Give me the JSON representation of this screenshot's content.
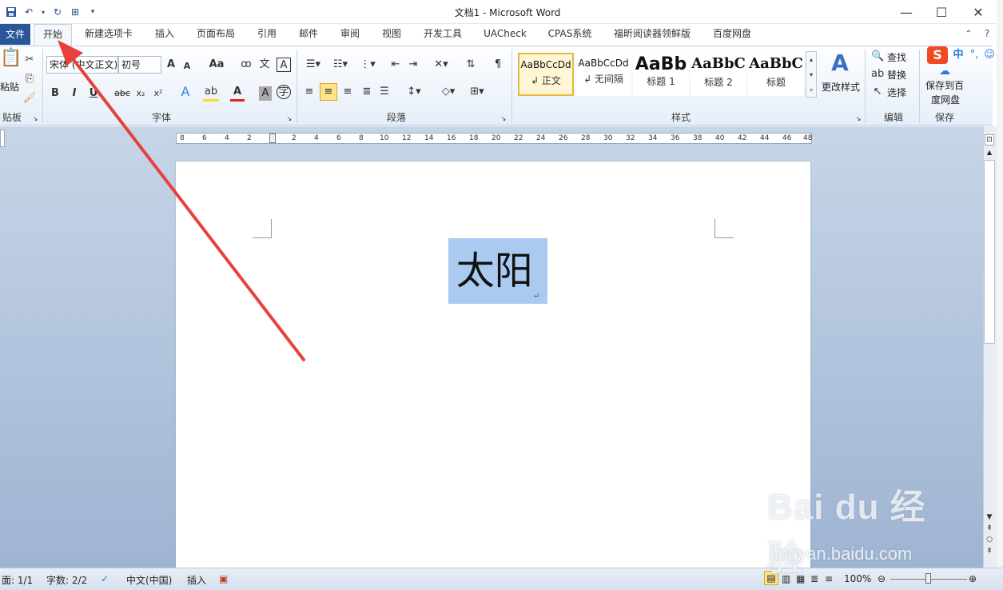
{
  "window": {
    "title": "文档1 - Microsoft Word",
    "minimize": "—",
    "maximize": "☐",
    "close": "✕"
  },
  "tabs": {
    "file": "文件",
    "items": [
      "开始",
      "新建选项卡",
      "插入",
      "页面布局",
      "引用",
      "邮件",
      "审阅",
      "视图",
      "开发工具",
      "UACheck",
      "CPAS系统",
      "福昕阅读器领鲜版",
      "百度网盘"
    ]
  },
  "ribbon": {
    "clipboard": {
      "paste": "粘贴",
      "label": "贴板"
    },
    "font": {
      "font_name": "宋体 (中文正文)",
      "font_size": "初号",
      "label": "字体"
    },
    "paragraph": {
      "label": "段落"
    },
    "styles": {
      "label": "样式",
      "items": [
        {
          "preview": "AaBbCcDd",
          "name": "↲ 正文"
        },
        {
          "preview": "AaBbCcDd",
          "name": "↲ 无间隔"
        },
        {
          "preview": "AaBb",
          "name": "标题 1"
        },
        {
          "preview": "AaBbC",
          "name": "标题 2"
        },
        {
          "preview": "AaBbC",
          "name": "标题"
        }
      ],
      "change_styles": "更改样式"
    },
    "editing": {
      "find": "查找",
      "replace": "替换",
      "select": "选择",
      "label": "编辑"
    },
    "save": {
      "line1": "保存到百",
      "line2": "度网盘",
      "label": "保存"
    },
    "ime": {
      "logo": "S",
      "mode": "中"
    }
  },
  "ruler": {
    "ticks": [
      "8",
      "6",
      "4",
      "2",
      "",
      "2",
      "4",
      "6",
      "8",
      "10",
      "12",
      "14",
      "16",
      "18",
      "20",
      "22",
      "24",
      "26",
      "28",
      "30",
      "32",
      "34",
      "36",
      "38",
      "40",
      "42",
      "44",
      "46",
      "48"
    ]
  },
  "document": {
    "selected_text": "太阳",
    "paragraph_mark": "↵"
  },
  "status": {
    "page": "面: 1/1",
    "words": "字数: 2/2",
    "language": "中文(中国)",
    "mode": "插入",
    "zoom": "100%"
  },
  "watermark": {
    "brand": "Bai du 经验",
    "url": "jingyan.baidu.com"
  },
  "colors": {
    "file_tab": "#2a5699",
    "selection": "#aacbef",
    "arrow": "#e8413b",
    "doc_bg": "#b3c6df"
  }
}
